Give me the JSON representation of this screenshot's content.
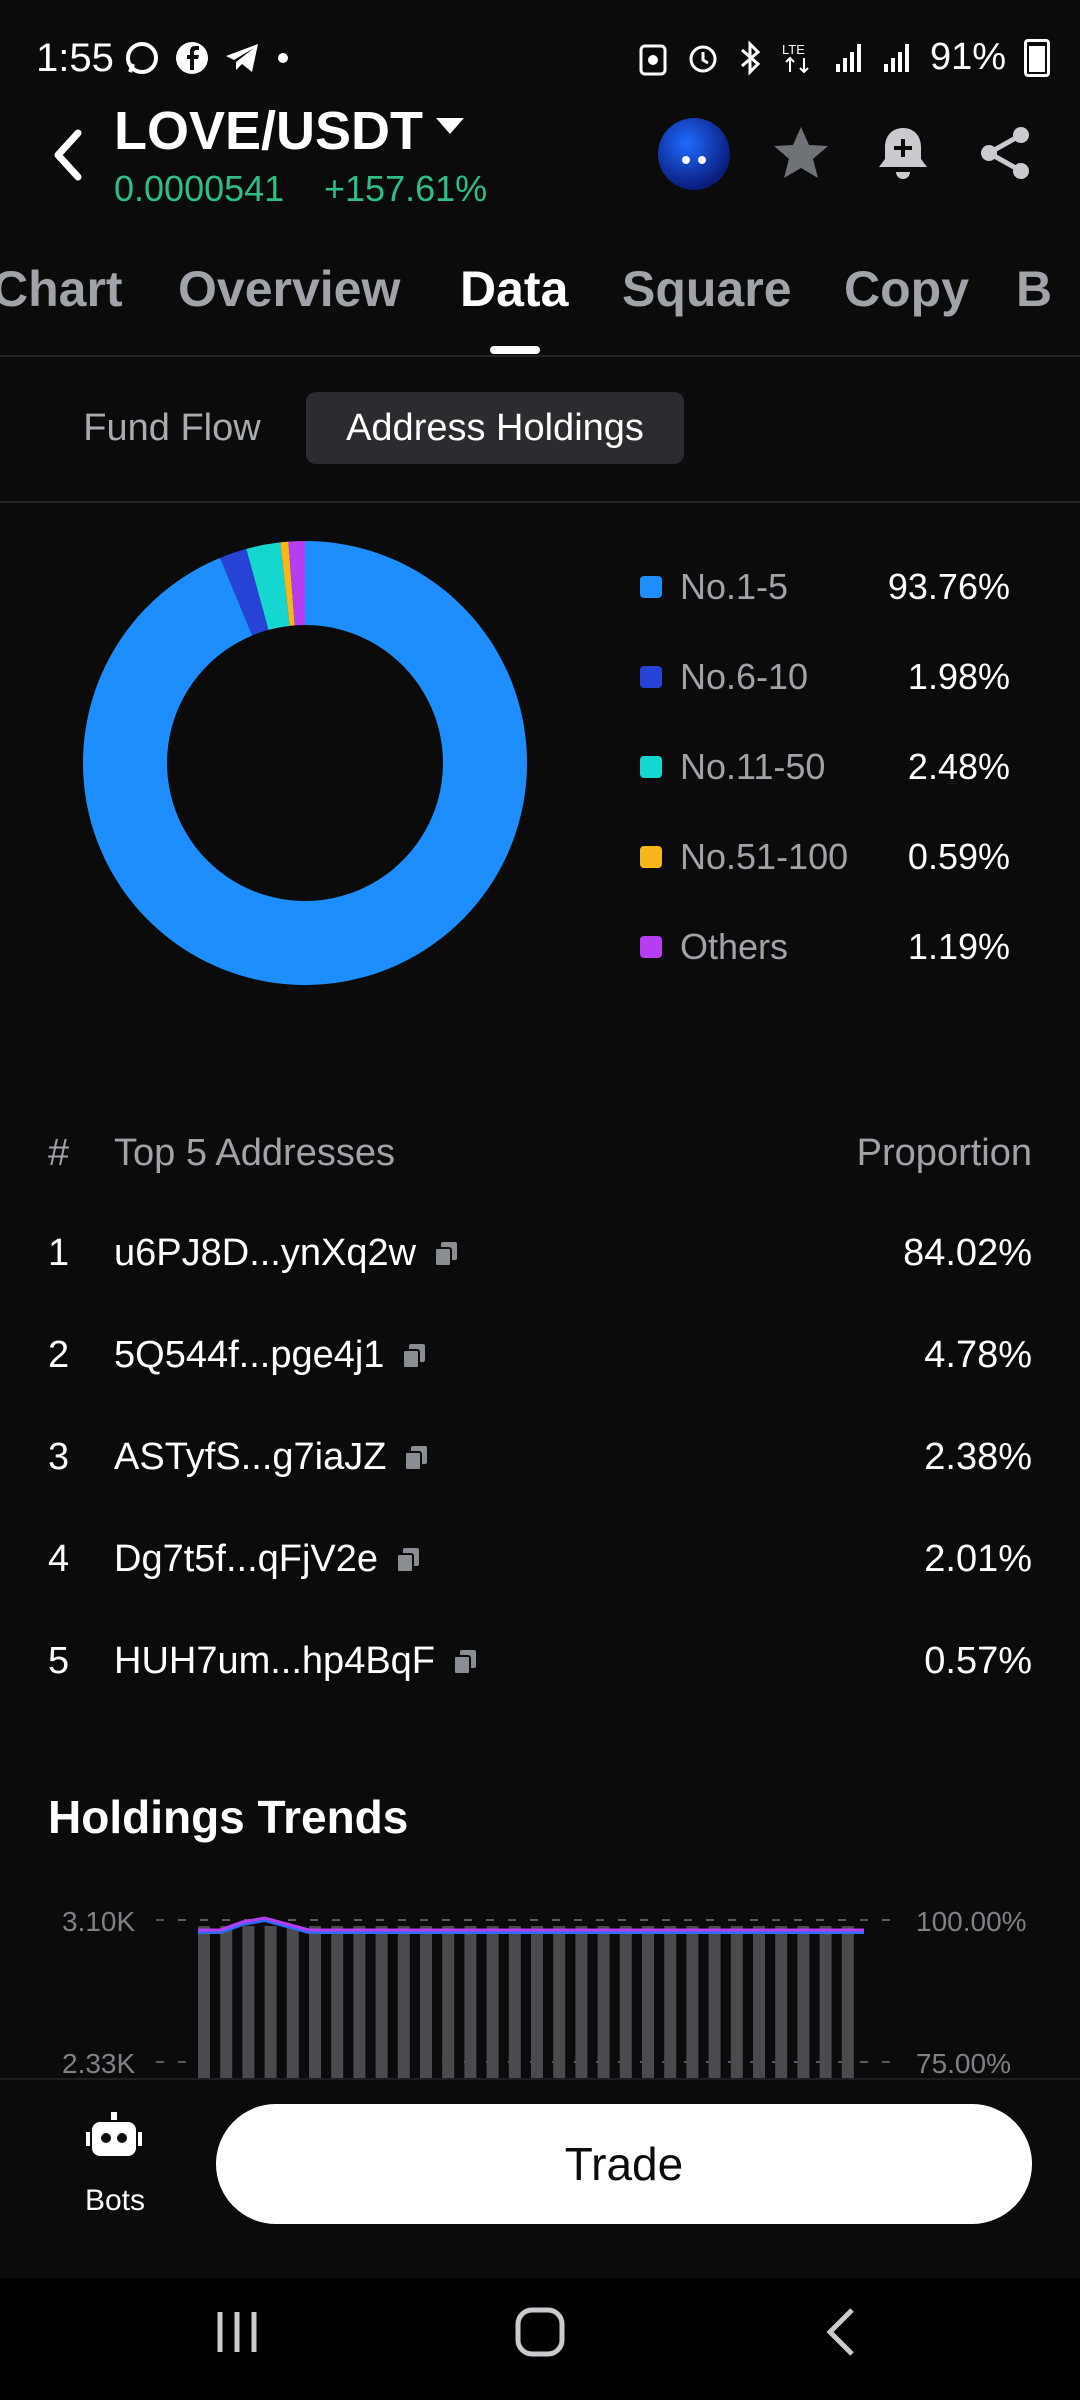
{
  "status_bar": {
    "time": "1:55",
    "battery": "91%",
    "left_icons": [
      "whatsapp-icon",
      "facebook-icon",
      "telegram-icon",
      "dot-icon"
    ],
    "right_icons": [
      "vpn-icon",
      "alarm-icon",
      "bluetooth-icon",
      "lte-icon",
      "signal-icon",
      "signal-icon",
      "battery-icon"
    ]
  },
  "header": {
    "pair": "LOVE/USDT",
    "price": "0.0000541",
    "change": "+157.61%",
    "icons": [
      "avatar",
      "star-icon",
      "bell-plus-icon",
      "share-icon"
    ]
  },
  "tabs": [
    {
      "label": "Chart"
    },
    {
      "label": "Overview"
    },
    {
      "label": "Data"
    },
    {
      "label": "Square"
    },
    {
      "label": "Copy"
    },
    {
      "label": "B"
    }
  ],
  "active_tab": "Data",
  "subtabs": [
    {
      "label": "Fund Flow"
    },
    {
      "label": "Address Holdings"
    }
  ],
  "active_subtab": "Address Holdings",
  "chart_data": [
    {
      "type": "pie",
      "categories": [
        "No.1-5",
        "No.6-10",
        "No.11-50",
        "No.51-100",
        "Others"
      ],
      "values": [
        93.76,
        1.98,
        2.48,
        0.59,
        1.19
      ],
      "value_labels": [
        "93.76%",
        "1.98%",
        "2.48%",
        "0.59%",
        "1.19%"
      ],
      "colors": [
        "#1e8efc",
        "#2743d6",
        "#16d6d0",
        "#f5b81a",
        "#b63ef0"
      ],
      "title": "",
      "legend": "right"
    },
    {
      "type": "bar",
      "title": "Holdings Trends",
      "left_axis_ticks": [
        "3.10K",
        "2.33K"
      ],
      "right_axis_ticks": [
        "100.00%",
        "75.00%"
      ],
      "line_colors": [
        "#2f6bff",
        "#b63ef0"
      ],
      "bar_color": "#4a4b4f",
      "grid": true
    }
  ],
  "table": {
    "headers": {
      "index": "#",
      "address": "Top 5 Addresses",
      "proportion": "Proportion"
    },
    "rows": [
      {
        "index": "1",
        "address": "u6PJ8D...ynXq2w",
        "proportion": "84.02%"
      },
      {
        "index": "2",
        "address": "5Q544f...pge4j1",
        "proportion": "4.78%"
      },
      {
        "index": "3",
        "address": "ASTyfS...g7iaJZ",
        "proportion": "2.38%"
      },
      {
        "index": "4",
        "address": "Dg7t5f...qFjV2e",
        "proportion": "2.01%"
      },
      {
        "index": "5",
        "address": "HUH7um...hp4BqF",
        "proportion": "0.57%"
      }
    ]
  },
  "trends": {
    "title": "Holdings Trends",
    "left_ticks": [
      "3.10K",
      "2.33K"
    ],
    "right_ticks": [
      "100.00%",
      "75.00%"
    ]
  },
  "bottom": {
    "bots_label": "Bots",
    "trade_label": "Trade"
  },
  "colors": {
    "positive": "#2ebd85",
    "background": "#0b0b0c",
    "muted": "#a0a3a8"
  }
}
